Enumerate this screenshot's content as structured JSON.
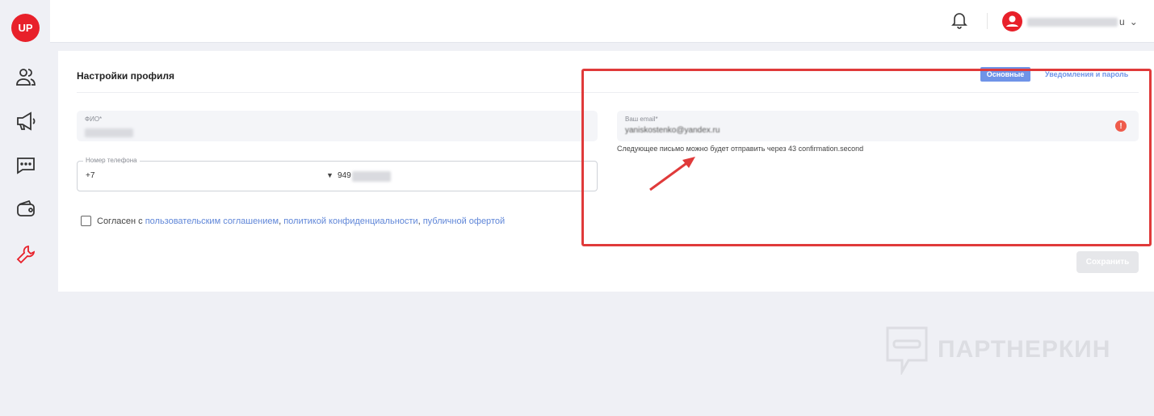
{
  "sidebar": {
    "logo": "UP",
    "items": [
      "users-icon",
      "megaphone-icon",
      "chat-icon",
      "wallet-icon",
      "wrench-icon"
    ]
  },
  "header": {
    "username_suffix": "u"
  },
  "card": {
    "title": "Настройки профиля",
    "tabs": [
      {
        "label": "Основные",
        "active": true
      },
      {
        "label": "Уведомления и пароль",
        "active": false
      }
    ],
    "fio": {
      "label": "ФИО*"
    },
    "phone": {
      "label": "Номер телефона",
      "code": "+7",
      "number_prefix": "949"
    },
    "email": {
      "label": "Ваш email*",
      "value_visible": "yaniskostenko@yandex.ru"
    },
    "helper": "Следующее письмо можно будет отправить через 43 confirmation.second",
    "agree": {
      "prefix": "Согласен с ",
      "link1": "пользовательским соглашением",
      "sep1": ", ",
      "link2": "политикой конфиденциальности",
      "sep2": ", ",
      "link3": "публичной офертой"
    },
    "save": "Сохранить"
  },
  "watermark": "ПАРТНЕРКИН",
  "colors": {
    "accent": "#6f94e8",
    "brand": "#e8202a",
    "annotation": "#e03a3a"
  }
}
